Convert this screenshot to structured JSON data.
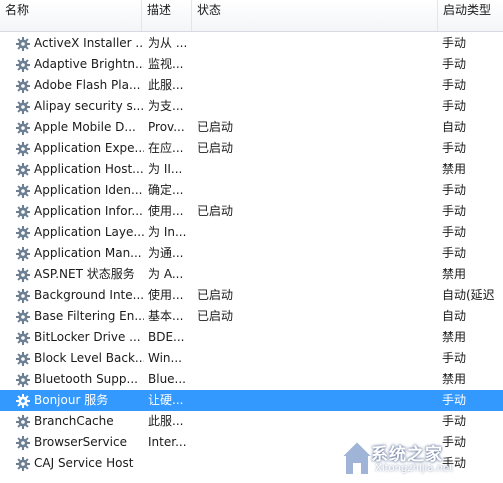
{
  "columns": {
    "name": "名称",
    "description": "描述",
    "status": "状态",
    "startup_type": "启动类型"
  },
  "services": [
    {
      "name": "ActiveX Installer ...",
      "description": "为从 ...",
      "status": "",
      "startup": "手动"
    },
    {
      "name": "Adaptive Brightn...",
      "description": "监视...",
      "status": "",
      "startup": "手动"
    },
    {
      "name": "Adobe Flash Pla...",
      "description": "此服...",
      "status": "",
      "startup": "手动"
    },
    {
      "name": "Alipay security s...",
      "description": "为支...",
      "status": "",
      "startup": "手动"
    },
    {
      "name": "Apple Mobile D...",
      "description": "Prov...",
      "status": "已启动",
      "startup": "自动"
    },
    {
      "name": "Application Expe...",
      "description": "在应...",
      "status": "已启动",
      "startup": "手动"
    },
    {
      "name": "Application Host...",
      "description": "为 II...",
      "status": "",
      "startup": "禁用"
    },
    {
      "name": "Application Iden...",
      "description": "确定...",
      "status": "",
      "startup": "手动"
    },
    {
      "name": "Application Infor...",
      "description": "使用...",
      "status": "已启动",
      "startup": "手动"
    },
    {
      "name": "Application Laye...",
      "description": "为 In...",
      "status": "",
      "startup": "手动"
    },
    {
      "name": "Application Man...",
      "description": "为通...",
      "status": "",
      "startup": "手动"
    },
    {
      "name": "ASP.NET 状态服务",
      "description": "为 A...",
      "status": "",
      "startup": "禁用"
    },
    {
      "name": "Background Inte...",
      "description": "使用...",
      "status": "已启动",
      "startup": "自动(延迟"
    },
    {
      "name": "Base Filtering En...",
      "description": "基本...",
      "status": "已启动",
      "startup": "自动"
    },
    {
      "name": "BitLocker Drive ...",
      "description": "BDE...",
      "status": "",
      "startup": "禁用"
    },
    {
      "name": "Block Level Back...",
      "description": "Win...",
      "status": "",
      "startup": "手动"
    },
    {
      "name": "Bluetooth Supp...",
      "description": "Blue...",
      "status": "",
      "startup": "禁用"
    },
    {
      "name": "Bonjour 服务",
      "description": "让硬...",
      "status": "",
      "startup": "手动",
      "selected": true
    },
    {
      "name": "BranchCache",
      "description": "此服...",
      "status": "",
      "startup": "手动"
    },
    {
      "name": "BrowserService",
      "description": "Inter...",
      "status": "",
      "startup": "手动"
    },
    {
      "name": "CAJ Service Host",
      "description": "",
      "status": "",
      "startup": "手动"
    }
  ],
  "watermark": {
    "text": "系统之家",
    "url": "Xitongzhijia.net"
  },
  "colors": {
    "selected_row": "#3399ff",
    "header_bg": "#f3f5f8",
    "gear_icon": "#6d7f93"
  }
}
